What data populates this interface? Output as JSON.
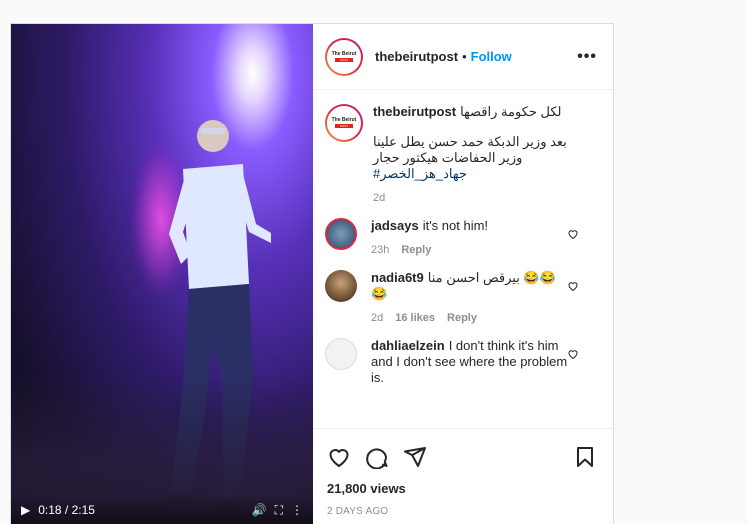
{
  "post": {
    "username": "thebeirutpost",
    "follow_label": "Follow",
    "dot": "•",
    "more_label": "•••",
    "logo_text": "The Beirut",
    "logo_sub": "POST"
  },
  "video": {
    "time": "0:18 / 2:15"
  },
  "caption": {
    "username": "thebeirutpost",
    "line1": "لكل حكومة راقصها",
    "line2": "بعد وزير الدبكة حمد حسن يطل علينا وزير الحفاضات هيكتور حجار",
    "hashtag": "#جهاد_هز_الخصر",
    "time": "2d"
  },
  "comments": [
    {
      "username": "jadsays",
      "text": "it's not him!",
      "time": "23h",
      "likes": "",
      "reply": "Reply",
      "avatar_color": "#4a6a8a"
    },
    {
      "username": "nadia6t9",
      "text": "😂😂 بيرقص احسن منا 😂",
      "time": "2d",
      "likes": "16 likes",
      "reply": "Reply",
      "avatar_color": "#7a5a3a"
    },
    {
      "username": "dahliaelzein",
      "text": "I don't think it's him and I don't see where the problem is.",
      "time": "",
      "likes": "",
      "reply": "",
      "avatar_color": "#e6e6e6"
    }
  ],
  "stats": {
    "views": "21,800 views",
    "posted": "2 DAYS AGO"
  }
}
